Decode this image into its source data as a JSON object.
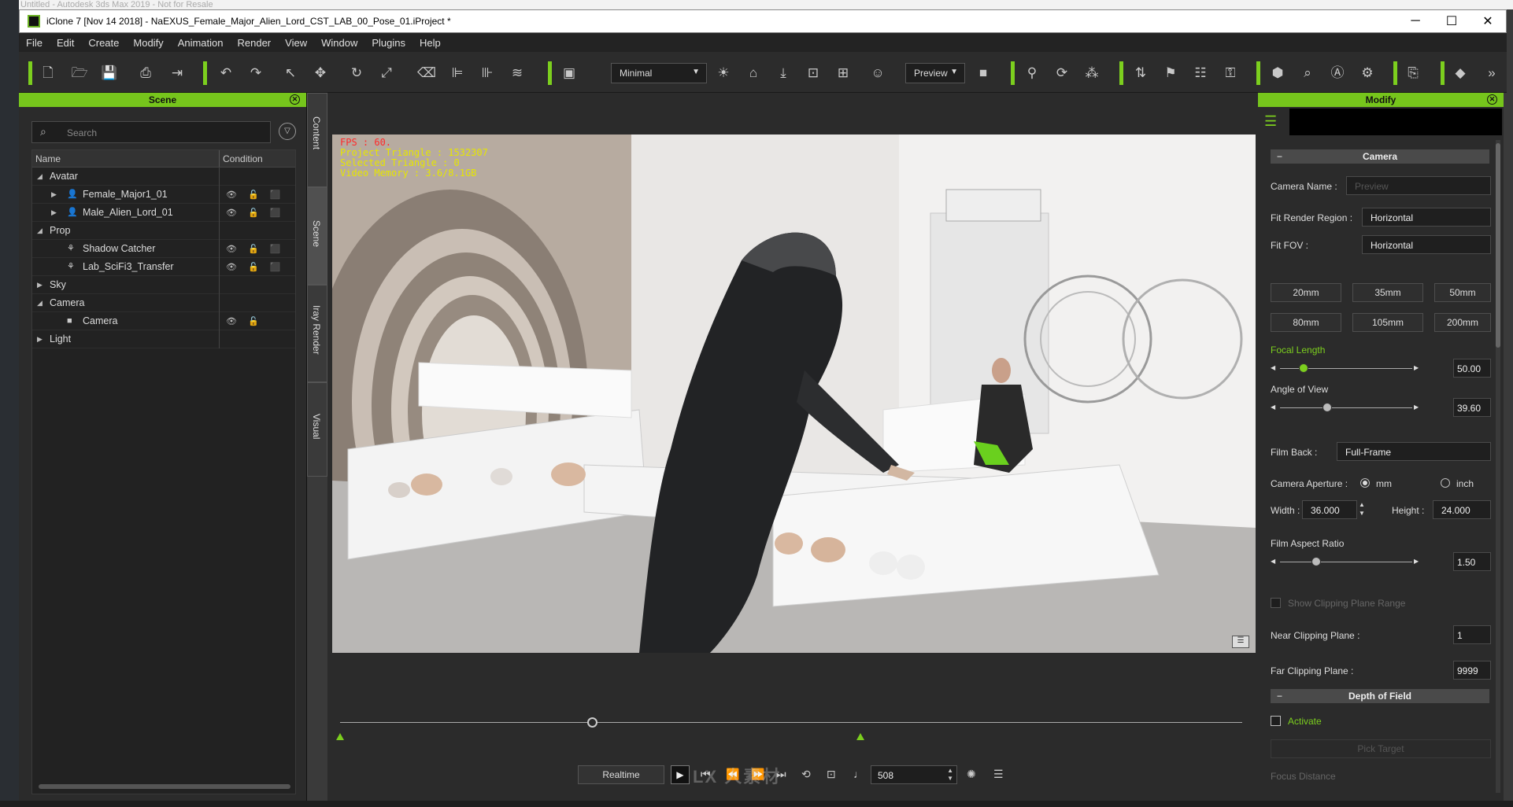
{
  "bg_title": "Untitled - Autodesk 3ds Max 2019 - Not for Resale",
  "window": {
    "title": "iClone 7 [Nov 14 2018] - NaEXUS_Female_Major_Alien_Lord_CST_LAB_00_Pose_01.iProject *",
    "minimize": "─",
    "maximize": "☐",
    "close": "✕"
  },
  "menu": [
    "File",
    "Edit",
    "Create",
    "Modify",
    "Animation",
    "Render",
    "View",
    "Window",
    "Plugins",
    "Help"
  ],
  "toolbar": {
    "display_mode": "Minimal",
    "camera_select": "Preview",
    "more": "»"
  },
  "scene_panel": {
    "title": "Scene",
    "search_placeholder": "Search",
    "col_name": "Name",
    "col_condition": "Condition",
    "rows": [
      {
        "label": "Avatar"
      },
      {
        "label": "Female_Major1_01"
      },
      {
        "label": "Male_Alien_Lord_01"
      },
      {
        "label": "Prop"
      },
      {
        "label": "Shadow Catcher"
      },
      {
        "label": "Lab_SciFi3_Transfer"
      },
      {
        "label": "Sky"
      },
      {
        "label": "Camera"
      },
      {
        "label": "Camera"
      },
      {
        "label": "Light"
      }
    ]
  },
  "side_tabs": [
    "Content",
    "Scene",
    "Iray Render",
    "Visual"
  ],
  "viewport": {
    "fps": "FPS : 60.",
    "triangles": "Project Triangle : 1532307",
    "selected": "Selected Triangle : 0",
    "memory": "Video Memory : 3.6/8.1GB"
  },
  "playback": {
    "realtime": "Realtime",
    "frame": "508",
    "timeline_position": 0.28
  },
  "watermark": "LX 人素材",
  "modify_panel": {
    "title": "Modify",
    "camera_section": "Camera",
    "camera_name_label": "Camera Name :",
    "camera_name_placeholder": "Preview",
    "fit_render_region_label": "Fit Render Region :",
    "fit_render_region_value": "Horizontal",
    "fit_fov_label": "Fit FOV :",
    "fit_fov_value": "Horizontal",
    "lens_buttons": [
      "20mm",
      "35mm",
      "50mm",
      "80mm",
      "105mm",
      "200mm"
    ],
    "focal_length_label": "Focal Length",
    "focal_length_value": "50.00",
    "angle_of_view_label": "Angle of View",
    "angle_of_view_value": "39.60",
    "film_back_label": "Film Back :",
    "film_back_value": "Full-Frame",
    "camera_aperture_label": "Camera Aperture :",
    "unit_mm": "mm",
    "unit_inch": "inch",
    "width_label": "Width :",
    "width_value": "36.000",
    "height_label": "Height :",
    "height_value": "24.000",
    "film_aspect_ratio_label": "Film Aspect Ratio",
    "film_aspect_ratio_value": "1.50",
    "show_clipping_label": "Show Clipping Plane Range",
    "near_clipping_label": "Near Clipping Plane :",
    "near_clipping_value": "1",
    "far_clipping_label": "Far Clipping Plane :",
    "far_clipping_value": "9999",
    "dof_section": "Depth of Field",
    "activate_label": "Activate",
    "pick_target_label": "Pick Target",
    "focus_distance_label": "Focus Distance"
  },
  "colors": {
    "accent_green": "#7ccf1e",
    "panel_bg": "#2b2b2b",
    "fps_red": "#ff2a2a",
    "stats_yellow": "#e6e600"
  }
}
